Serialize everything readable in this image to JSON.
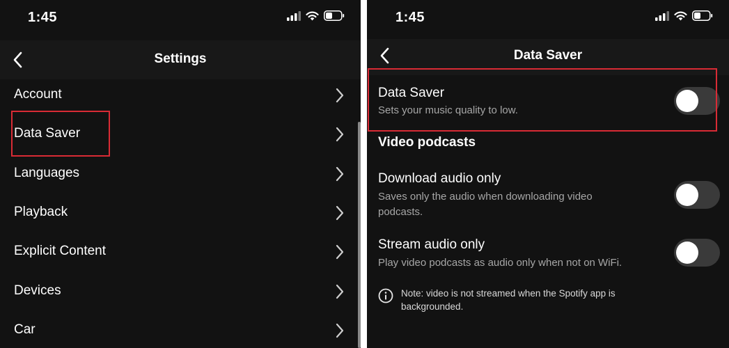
{
  "status_bar": {
    "time": "1:45"
  },
  "settings_screen": {
    "title": "Settings",
    "items": [
      {
        "label": "Account"
      },
      {
        "label": "Data Saver"
      },
      {
        "label": "Languages"
      },
      {
        "label": "Playback"
      },
      {
        "label": "Explicit Content"
      },
      {
        "label": "Devices"
      },
      {
        "label": "Car"
      }
    ]
  },
  "data_saver_screen": {
    "title": "Data Saver",
    "data_saver": {
      "title": "Data Saver",
      "description": "Sets your music quality to low.",
      "enabled": false
    },
    "section_title": "Video podcasts",
    "download_audio_only": {
      "title": "Download audio only",
      "description": "Saves only the audio when downloading video podcasts.",
      "enabled": false
    },
    "stream_audio_only": {
      "title": "Stream audio only",
      "description": "Play video podcasts as audio only when not on WiFi.",
      "enabled": false
    },
    "note": "Note: video is not streamed when the Spotify app is backgrounded."
  },
  "colors": {
    "background": "#121212",
    "header": "#181818",
    "highlight": "#d92b35",
    "toggle_off": "#3a3a3a",
    "secondary_text": "#a7a7a7"
  }
}
